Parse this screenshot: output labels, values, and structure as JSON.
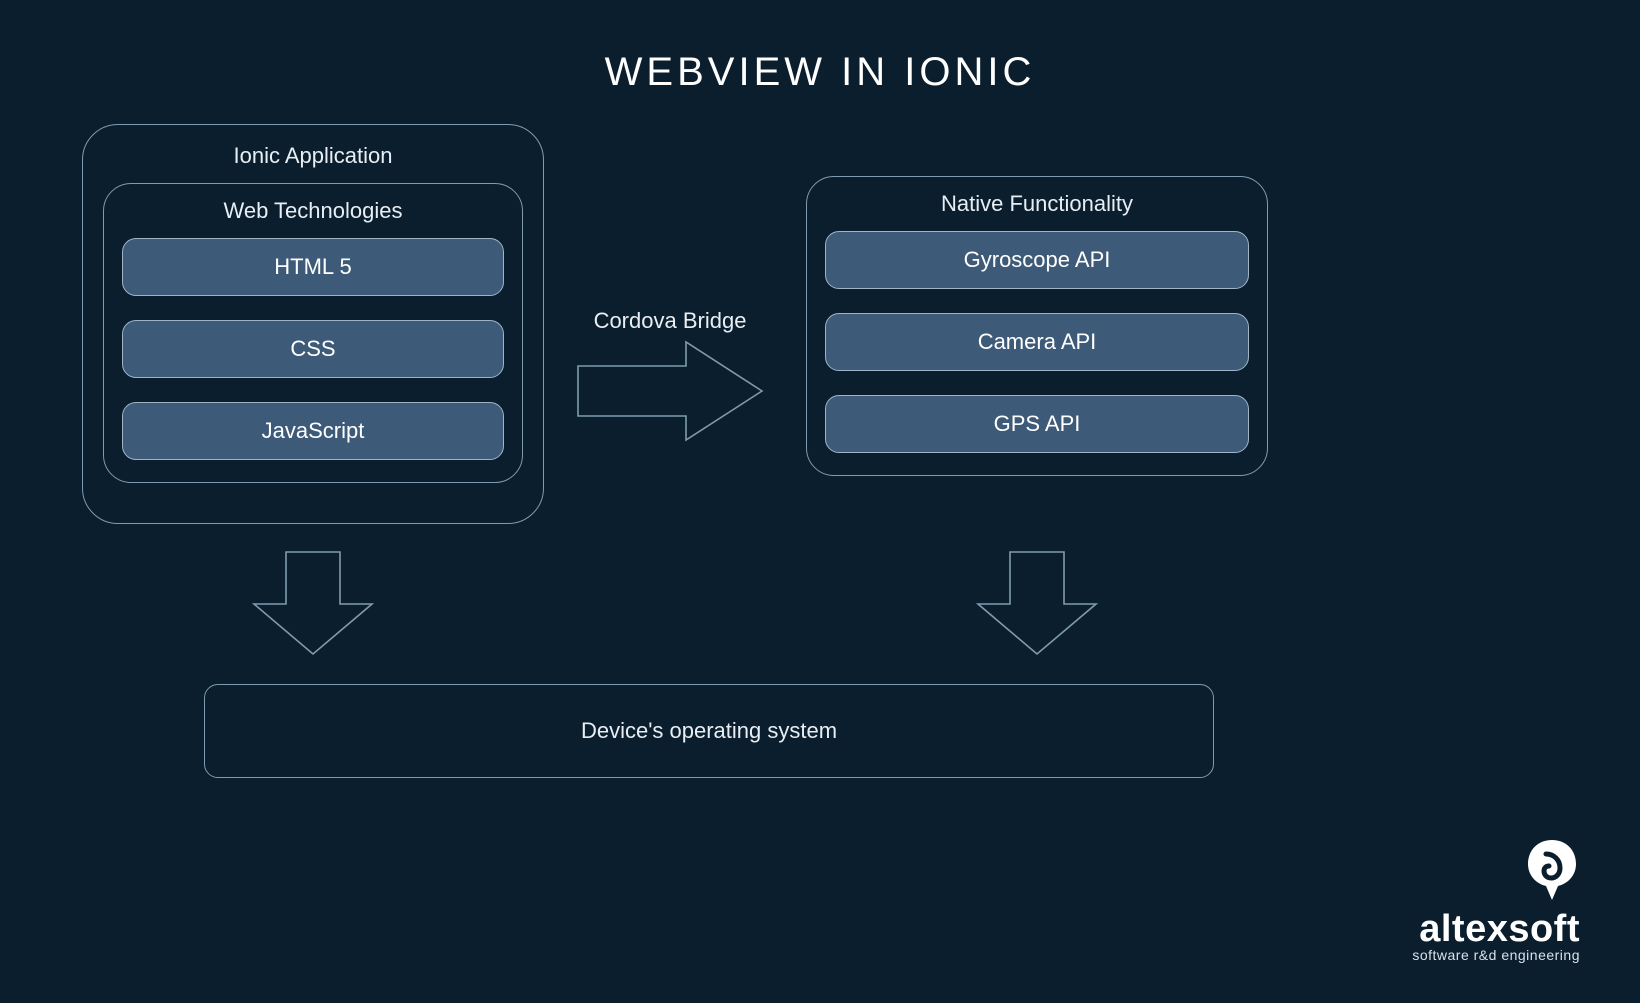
{
  "title": "WEBVIEW IN IONIC",
  "ionicApp": {
    "label": "Ionic Application",
    "webTech": {
      "label": "Web Technologies",
      "items": [
        "HTML 5",
        "CSS",
        "JavaScript"
      ]
    }
  },
  "bridge": {
    "label": "Cordova Bridge"
  },
  "nativeFunc": {
    "label": "Native Functionality",
    "items": [
      "Gyroscope API",
      "Camera API",
      "GPS API"
    ]
  },
  "os": {
    "label": "Device's operating system"
  },
  "logo": {
    "name": "altexsoft",
    "tagline": "software r&d engineering"
  },
  "colors": {
    "background": "#0a1e2e",
    "stroke": "#7f9bb0",
    "pillFill": "#3d5a78",
    "text": "#e8eef3"
  }
}
